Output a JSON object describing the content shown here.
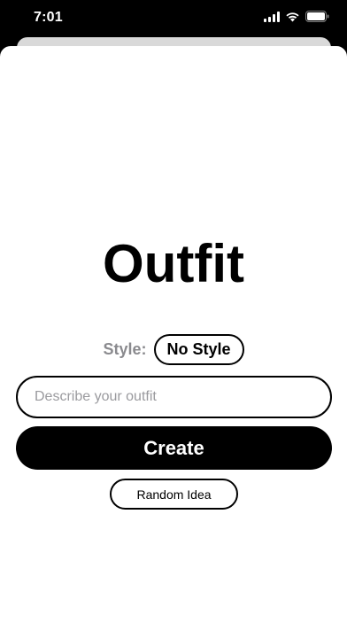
{
  "status_bar": {
    "time": "7:01",
    "icons": [
      "signal-icon",
      "wifi-icon",
      "battery-icon"
    ]
  },
  "main": {
    "title": "Outfit",
    "style_label": "Style:",
    "style_value": "No Style",
    "input_placeholder": "Describe your outfit",
    "input_value": "",
    "create_label": "Create",
    "random_label": "Random Idea"
  },
  "colors": {
    "background": "#000000",
    "sheet": "#ffffff",
    "accent": "#000000",
    "muted_text": "#8a8a8e"
  }
}
